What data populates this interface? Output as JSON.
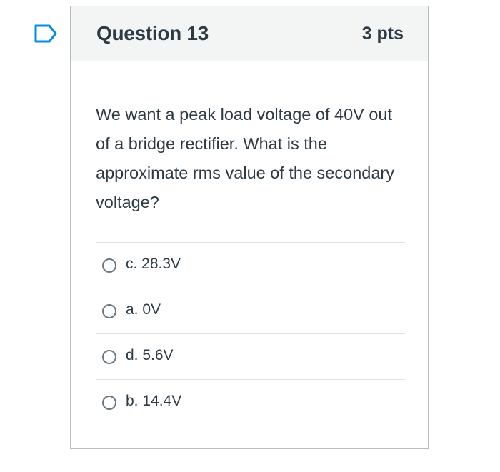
{
  "question": {
    "title": "Question 13",
    "points": "3 pts",
    "text": "We want a peak load voltage of 40V out of a bridge rectifier. What is the approximate rms value of the secondary voltage?",
    "answers": [
      {
        "label": "c. 28.3V",
        "selected": false
      },
      {
        "label": "a. 0V",
        "selected": false
      },
      {
        "label": "d. 5.6V",
        "selected": false
      },
      {
        "label": "b. 14.4V",
        "selected": false
      }
    ]
  },
  "icons": {
    "flag": "flag-question-icon",
    "radio": "radio-unselected-icon"
  },
  "colors": {
    "text": "#2d3b45",
    "header_background": "#f3f4f4",
    "border": "#b9bcc0",
    "flag": "#008ee2"
  }
}
